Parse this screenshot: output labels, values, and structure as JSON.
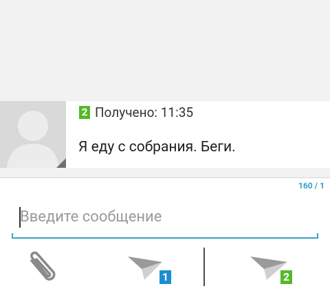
{
  "message": {
    "sim_badge": "2",
    "status": "Получено: 11:35",
    "text": "Я еду с собрания. Беги."
  },
  "compose": {
    "char_counter": "160 / 1",
    "placeholder": "Введите сообщение",
    "send_sim1_label": "1",
    "send_sim2_label": "2"
  },
  "colors": {
    "sim1": "#1a8fd0",
    "sim2": "#56b82a",
    "accent": "#35a3c8"
  },
  "icons": [
    "paperclip-icon",
    "send-icon",
    "send-icon"
  ]
}
